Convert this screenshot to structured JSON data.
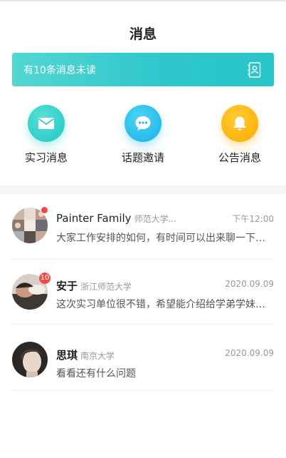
{
  "header": {
    "title": "消息"
  },
  "banner": {
    "text": "有10条消息未读",
    "icon": "contacts-icon",
    "color_start": "#53d7d2",
    "color_end": "#29c3cb"
  },
  "categories": [
    {
      "label": "实习消息",
      "icon": "envelope-icon",
      "color": "#2fcfc7"
    },
    {
      "label": "话题邀请",
      "icon": "chat-bubble-icon",
      "color": "#1fb9ea"
    },
    {
      "label": "公告消息",
      "icon": "bell-icon",
      "color": "#ffb000"
    }
  ],
  "messages": [
    {
      "name": "Painter Family",
      "school": "师范大学...",
      "time": "下午12:00",
      "preview": "大家工作安排的如何，有时间可以出来聊一下…",
      "badge": ""
    },
    {
      "name": "安于",
      "school": "浙江师范大学",
      "time": "2020.09.09",
      "preview": "这次实习单位很不错，希望能介绍给学弟学妹…",
      "badge": "10"
    },
    {
      "name": "思琪",
      "school": "南京大学",
      "time": "2020.09.09",
      "preview": "看看还有什么问题",
      "badge": ""
    }
  ]
}
